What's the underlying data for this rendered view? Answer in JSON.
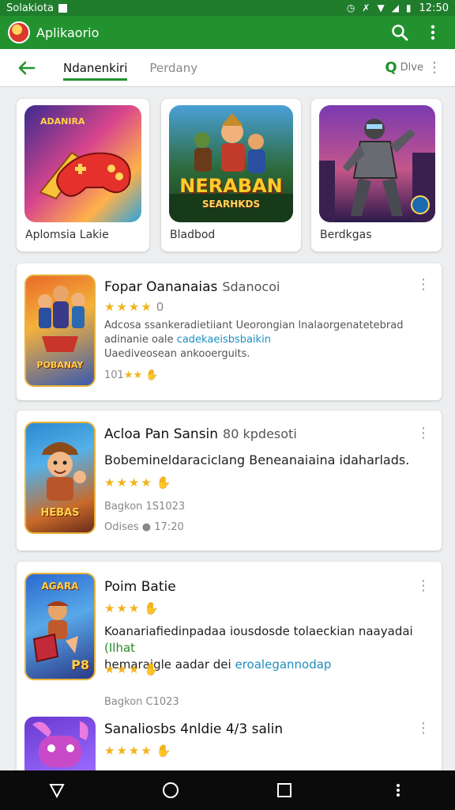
{
  "status_bar": {
    "title": "Solakiota",
    "time": "12:50"
  },
  "app_bar": {
    "title": "Aplikaorio"
  },
  "tabs": [
    {
      "label": "Ndanenkiri"
    },
    {
      "label": "Perdany"
    }
  ],
  "chip": {
    "label": "Dlve"
  },
  "featured": [
    {
      "caption": "Aplomsia Lakie"
    },
    {
      "caption": "Bladbod",
      "art_title": "NERABAN",
      "art_subtitle": "SEARHKDS"
    },
    {
      "caption": "Berdkgas"
    }
  ],
  "apps": [
    {
      "name": "Fopar Oananaias",
      "subtitle": "Sdanocoi",
      "rating_text": "0",
      "desc_plain": "Adcosa ssankeradietiiant Ueorongian lnalaorgenatetebrad adinanie oale ",
      "desc_link": "cadekaeisbsbaikin",
      "desc_tail": "Uaediveosean ankooerguits.",
      "meta": "101",
      "icon_label": "POBANAY"
    },
    {
      "name": "Acloa Pan Sansin",
      "subtitle": "80 kpdesoti",
      "desc_plain": "Bobemineldaraciclang Beneanaiaina idaharlads.",
      "meta_date": "Bagkon 1S1023",
      "meta_size": "Odises",
      "meta_time": "17:20",
      "icon_label": "HEBAS"
    },
    {
      "name": "Poim Batie",
      "desc_plain": "Koanariafiedinpadaa iousdosde tolaeckian naayadai",
      "desc_green": "(Ilhat",
      "desc_plain2": "hemaraigle aadar dei",
      "desc_link": "eroalegannodap",
      "icon_label": "AGARA",
      "icon_num": "P8"
    },
    {
      "date": "Bagkon C1023",
      "name": "Sanaliosbs 4nldie 4/3 salin"
    }
  ],
  "colors": {
    "primary": "#22922f",
    "status": "#1f7d2c",
    "star": "#f1b31a",
    "link": "#1e8fbd"
  }
}
